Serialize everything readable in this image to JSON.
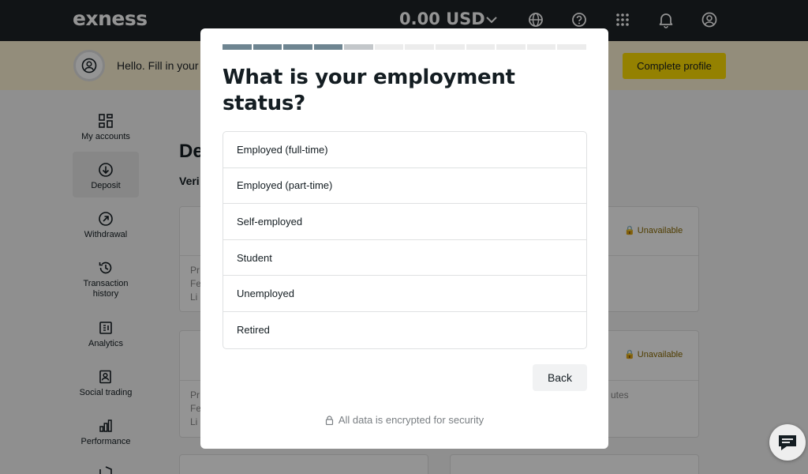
{
  "topbar": {
    "logo": "exness",
    "balance": "0.00 USD",
    "icons": [
      "chevron-down-icon",
      "globe-icon",
      "help-icon",
      "apps-grid-icon",
      "bell-icon",
      "user-icon"
    ]
  },
  "banner": {
    "text": "Hello. Fill in your a",
    "button_label": "Complete profile"
  },
  "sidebar": {
    "items": [
      {
        "label": "My accounts",
        "icon": "accounts-icon"
      },
      {
        "label": "Deposit",
        "icon": "deposit-icon",
        "active": true
      },
      {
        "label": "Withdrawal",
        "icon": "withdrawal-icon"
      },
      {
        "label": "Transaction history",
        "icon": "history-icon"
      },
      {
        "label": "Analytics",
        "icon": "analytics-icon"
      },
      {
        "label": "Social trading",
        "icon": "social-trading-icon"
      },
      {
        "label": "Performance",
        "icon": "performance-icon"
      }
    ]
  },
  "main": {
    "heading": "De",
    "subheading": "Veri",
    "cards": {
      "unavailable_label": "Unavailable",
      "snippet_a": "Pr",
      "snippet_b": "Fe",
      "snippet_c": "Li",
      "minutes_fragment": "utes"
    }
  },
  "modal": {
    "progress": {
      "total_steps": 12,
      "completed_steps": 4,
      "current_step": 5
    },
    "title": "What is your employment status?",
    "options": [
      "Employed (full-time)",
      "Employed (part-time)",
      "Self-employed",
      "Student",
      "Unemployed",
      "Retired"
    ],
    "back_label": "Back",
    "security_note": "All data is encrypted for security"
  },
  "colors": {
    "topbar": "#1e2327",
    "banner": "#fdf3d4",
    "accent_yellow": "#ffde02",
    "progress_done": "#6e8591",
    "progress_current": "#c3c7ca"
  }
}
